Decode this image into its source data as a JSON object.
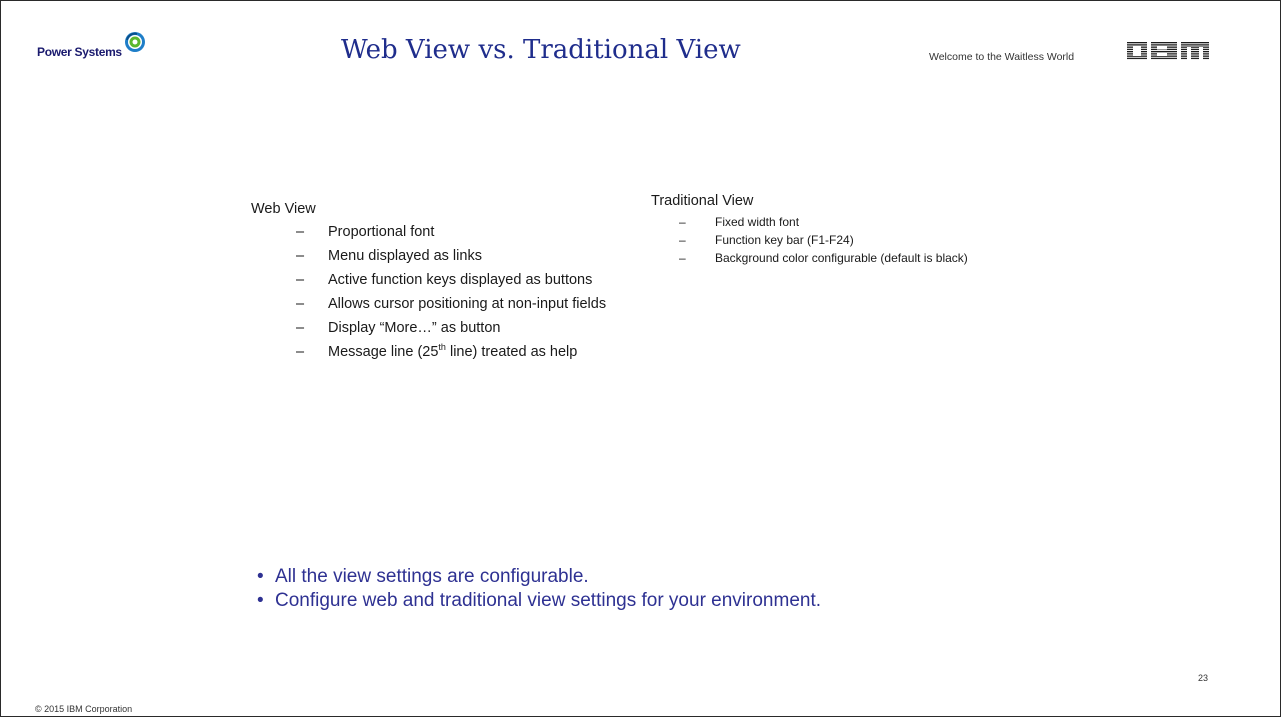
{
  "header": {
    "brand": "Power Systems",
    "title": "Web View vs. Traditional View",
    "tagline": "Welcome to the Waitless World",
    "ibm_logo_text": "IBM"
  },
  "web_view": {
    "heading": "Web View",
    "items": [
      {
        "text": "Proportional font"
      },
      {
        "text": "Menu displayed as links"
      },
      {
        "text": "Active function keys displayed as buttons"
      },
      {
        "text": "Allows cursor positioning at non-input fields"
      },
      {
        "text": "Display “More…” as button"
      },
      {
        "text_before": "Message line (25",
        "sup": "th",
        "text_after": " line) treated as help"
      }
    ]
  },
  "traditional_view": {
    "heading": "Traditional View",
    "items": [
      "Fixed width font",
      "Function key bar (F1-F24)",
      "Background color configurable (default is black)"
    ]
  },
  "bullets": [
    "All the view settings are configurable.",
    "Configure web and traditional view settings for your environment."
  ],
  "footer": {
    "copyright": "© 2015 IBM Corporation",
    "page_number": "23"
  },
  "colors": {
    "title": "#1f2d8c",
    "bullets": "#2e3192",
    "border": "#2a2a2a"
  },
  "symbols": {
    "dash": "–",
    "bullet": "•"
  }
}
